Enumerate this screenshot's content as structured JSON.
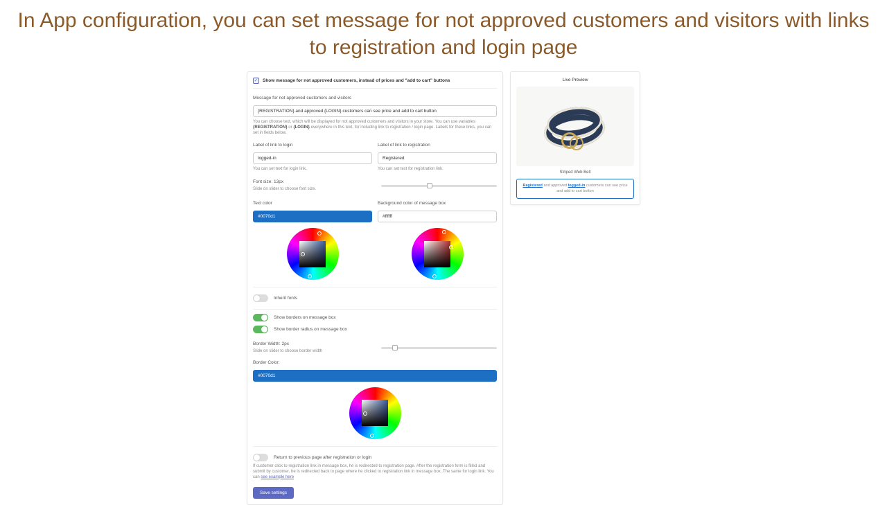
{
  "title": "In App configuration, you can set message for not approved customers and visitors with links to registration and login page",
  "main_checkbox": "Show message for not approved customers, instead of prices and \"add to cart\" buttons",
  "message": {
    "label": "Message for not approved customers and visitors",
    "value": "{REGISTRATION} and approved {LOGIN} customers can see price and add to cart button",
    "help_pre": "You can choose text, which will be displayed for not approved customers and visitors in your store. You can use variables ",
    "help_reg": "{REGISTRATION}",
    "help_mid": " or ",
    "help_log": "{LOGIN}",
    "help_post": " everywhere in this text, for including link to registration / login page. Labels for these links, you can set in fields below."
  },
  "login_link": {
    "label": "Label of link to login",
    "value": "logged-in",
    "help": "You can set text for login link."
  },
  "reg_link": {
    "label": "Label of link to registration",
    "value": "Registered",
    "help": "You can set text for registration link."
  },
  "font_size": {
    "label": "Font size: 13px",
    "help": "Slide on slider to choose font size."
  },
  "text_color": {
    "label": "Text color",
    "value": "#0070d1"
  },
  "bg_color": {
    "label": "Background color of message box",
    "value": "#ffffff"
  },
  "inherit_fonts": "Inherit fonts",
  "show_borders": "Show borders on message box",
  "show_radius": "Show border radius on message box",
  "border_width": {
    "label": "Border Width: 2px",
    "help": "Slide on slider to choose border width"
  },
  "border_color": {
    "label": "Border Color:",
    "value": "#0070d1"
  },
  "return_prev": "Return to previous page after registration or login",
  "return_help": "If customer click to registration link in message box, he is redirected to registration page. After the registration form is filled and submit by customer, he is redirected back to page where he clicked to registration link in message box. The same for login link. You can ",
  "return_link": "see example here",
  "save": "Save settings",
  "preview": {
    "title": "Live Preview",
    "product": "Striped Web Belt",
    "msg_reg": "Registered",
    "msg_mid1": " and approved ",
    "msg_login": "logged-in",
    "msg_mid2": " customers can see price and add to cart button"
  }
}
